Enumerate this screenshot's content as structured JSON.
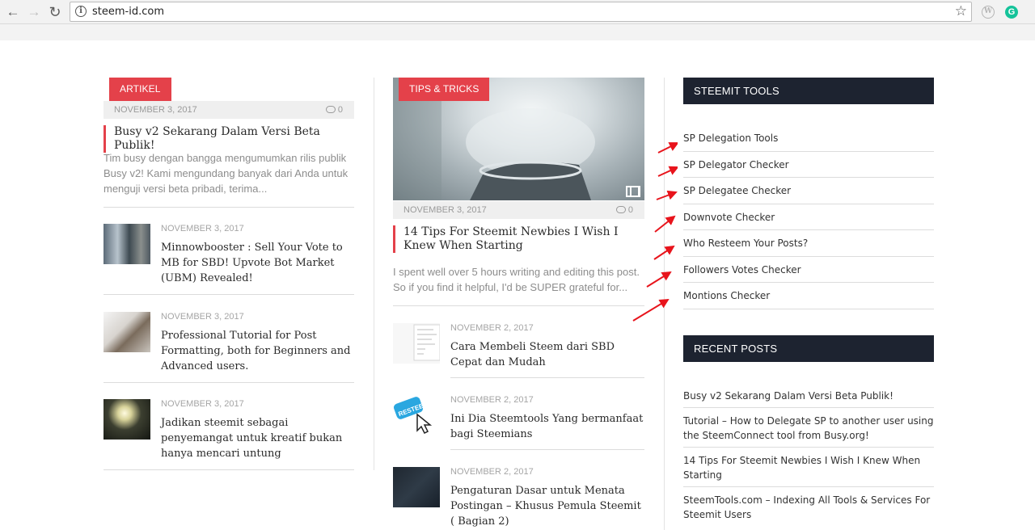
{
  "browser": {
    "url": "steem-id.com",
    "back_glyph": "←",
    "forward_glyph": "→",
    "reload_glyph": "↻",
    "star_glyph": "☆",
    "info_glyph": "i",
    "ext1_glyph": "W",
    "ext2_glyph": "G"
  },
  "col1": {
    "badge": "ARTIKEL",
    "featured": {
      "date": "NOVEMBER 3, 2017",
      "comments": "0",
      "title": "Busy v2 Sekarang Dalam Versi Beta Publik!",
      "excerpt": "Tim busy dengan bangga mengumumkan rilis publik Busy v2! Kami mengundang banyak dari Anda untuk menguji versi beta pribadi, terima..."
    },
    "posts": [
      {
        "date": "NOVEMBER 3, 2017",
        "title": "Minnowbooster : Sell Your Vote to MB for SBD! Upvote Bot Market (UBM) Revealed!"
      },
      {
        "date": "NOVEMBER 3, 2017",
        "title": "Professional Tutorial for Post Formatting, both for Beginners and Advanced users."
      },
      {
        "date": "NOVEMBER 3, 2017",
        "title": "Jadikan steemit sebagai penyemangat untuk kreatif bukan hanya mencari untung"
      }
    ]
  },
  "col2": {
    "badge": "TIPS & TRICKS",
    "featured": {
      "date": "NOVEMBER 3, 2017",
      "comments": "0",
      "title": "14 Tips For Steemit Newbies I Wish I Knew When Starting",
      "excerpt": "I spent well over 5 hours writing and editing this post. So if you find it helpful, I'd be SUPER grateful for..."
    },
    "posts": [
      {
        "date": "NOVEMBER 2, 2017",
        "title": "Cara Membeli Steem dari SBD Cepat dan Mudah"
      },
      {
        "date": "NOVEMBER 2, 2017",
        "title": "Ini Dia Steemtools Yang bermanfaat bagi Steemians",
        "thumb_text": "RESTEEM"
      },
      {
        "date": "NOVEMBER 2, 2017",
        "title": "Pengaturan Dasar untuk Menata Postingan – Khusus Pemula Steemit ( Bagian 2)"
      }
    ]
  },
  "sidebar": {
    "tools_title": "STEEMIT TOOLS",
    "tools": [
      "SP Delegation Tools",
      "SP Delegator Checker",
      "SP Delegatee Checker",
      "Downvote Checker",
      "Who Resteem Your Posts?",
      "Followers Votes Checker",
      "Montions Checker"
    ],
    "recent_title": "RECENT POSTS",
    "recent": [
      "Busy v2 Sekarang Dalam Versi Beta Publik!",
      "Tutorial – How to Delegate SP to another user using the SteemConnect tool from Busy.org!",
      "14 Tips For Steemit Newbies I Wish I Knew When Starting",
      "SteemTools.com – Indexing All Tools & Services For Steemit Users"
    ]
  },
  "colors": {
    "accent": "#e4414a",
    "widget_head": "#1d2330",
    "arrow": "#e8141c"
  }
}
